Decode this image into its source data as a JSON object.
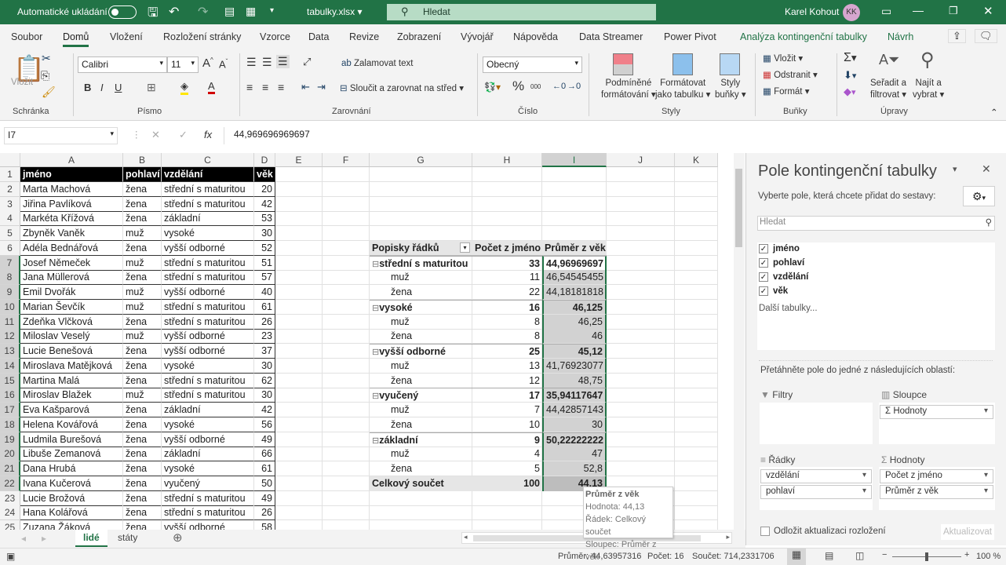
{
  "titlebar": {
    "autosave_label": "Automatické ukládání",
    "filename": "tabulky.xlsx",
    "search_placeholder": "Hledat",
    "user": "Karel Kohout",
    "initials": "KK"
  },
  "tabs": [
    "Soubor",
    "Domů",
    "Vložení",
    "Rozložení stránky",
    "Vzorce",
    "Data",
    "Revize",
    "Zobrazení",
    "Vývojář",
    "Nápověda",
    "Data Streamer",
    "Power Pivot",
    "Analýza kontingenční tabulky",
    "Návrh"
  ],
  "ribbon": {
    "paste": "Vložit",
    "clipboard": "Schránka",
    "font_name": "Calibri",
    "font_size": "11",
    "bold": "B",
    "italic": "I",
    "underline": "U",
    "font": "Písmo",
    "wrap": "Zalamovat text",
    "merge": "Sloučit a zarovnat na střed",
    "alignment": "Zarovnání",
    "number_format": "Obecný",
    "percent": "%",
    "thousands": "000",
    "number": "Číslo",
    "cond_format": [
      "Podmíněné",
      "formátování"
    ],
    "format_table": [
      "Formátovat",
      "jako tabulku"
    ],
    "cell_styles": [
      "Styly",
      "buňky"
    ],
    "styles": "Styly",
    "insert": "Vložit",
    "delete": "Odstranit",
    "format": "Formát",
    "cells": "Buňky",
    "sort": [
      "Seřadit a",
      "filtrovat"
    ],
    "find": [
      "Najít a",
      "vybrat"
    ],
    "editing": "Úpravy"
  },
  "formula": {
    "namebox": "I7",
    "value": "44,969696969697"
  },
  "columns": [
    "A",
    "B",
    "C",
    "D",
    "E",
    "F",
    "G",
    "H",
    "I",
    "J",
    "K"
  ],
  "rows": [
    [
      "jméno",
      "pohlaví",
      "vzdělání",
      "věk"
    ],
    [
      "Marta Machová",
      "žena",
      "střední s maturitou",
      "20"
    ],
    [
      "Jiřina Pavlíková",
      "žena",
      "střední s maturitou",
      "42"
    ],
    [
      "Markéta Křížová",
      "žena",
      "základní",
      "53"
    ],
    [
      "Zbyněk Vaněk",
      "muž",
      "vysoké",
      "30"
    ],
    [
      "Adéla Bednářová",
      "žena",
      "vyšší odborné",
      "52"
    ],
    [
      "Josef Němeček",
      "muž",
      "střední s maturitou",
      "51"
    ],
    [
      "Jana Müllerová",
      "žena",
      "střední s maturitou",
      "57"
    ],
    [
      "Emil Dvořák",
      "muž",
      "vyšší odborné",
      "40"
    ],
    [
      "Marian Ševčík",
      "muž",
      "střední s maturitou",
      "61"
    ],
    [
      "Zdeňka Vlčková",
      "žena",
      "střední s maturitou",
      "26"
    ],
    [
      "Miloslav Veselý",
      "muž",
      "vyšší odborné",
      "23"
    ],
    [
      "Lucie Benešová",
      "žena",
      "vyšší odborné",
      "37"
    ],
    [
      "Miroslava Matějková",
      "žena",
      "vysoké",
      "30"
    ],
    [
      "Martina Malá",
      "žena",
      "střední s maturitou",
      "62"
    ],
    [
      "Miroslav Blažek",
      "muž",
      "střední s maturitou",
      "30"
    ],
    [
      "Eva Kašparová",
      "žena",
      "základní",
      "42"
    ],
    [
      "Helena Kovářová",
      "žena",
      "vysoké",
      "56"
    ],
    [
      "Ludmila Burešová",
      "žena",
      "vyšší odborné",
      "49"
    ],
    [
      "Libuše Zemanová",
      "žena",
      "základní",
      "66"
    ],
    [
      "Dana Hrubá",
      "žena",
      "vysoké",
      "61"
    ],
    [
      "Ivana Kučerová",
      "žena",
      "vyučený",
      "50"
    ],
    [
      "Lucie Brožová",
      "žena",
      "střední s maturitou",
      "49"
    ],
    [
      "Hana Kolářová",
      "žena",
      "střední s maturitou",
      "26"
    ],
    [
      "Zuzana Žáková",
      "žena",
      "vyšší odborné",
      "58"
    ]
  ],
  "pivot": {
    "headers": [
      "Popisky řádků",
      "Počet z jméno",
      "Průměr z věk"
    ],
    "rows": [
      {
        "label": "střední s maturitou",
        "count": "33",
        "avg": "44,96969697",
        "group": true
      },
      {
        "label": "muž",
        "count": "11",
        "avg": "46,54545455",
        "group": false
      },
      {
        "label": "žena",
        "count": "22",
        "avg": "44,18181818",
        "group": false
      },
      {
        "label": "vysoké",
        "count": "16",
        "avg": "46,125",
        "group": true
      },
      {
        "label": "muž",
        "count": "8",
        "avg": "46,25",
        "group": false
      },
      {
        "label": "žena",
        "count": "8",
        "avg": "46",
        "group": false
      },
      {
        "label": "vyšší odborné",
        "count": "25",
        "avg": "45,12",
        "group": true
      },
      {
        "label": "muž",
        "count": "13",
        "avg": "41,76923077",
        "group": false
      },
      {
        "label": "žena",
        "count": "12",
        "avg": "48,75",
        "group": false
      },
      {
        "label": "vyučený",
        "count": "17",
        "avg": "35,94117647",
        "group": true
      },
      {
        "label": "muž",
        "count": "7",
        "avg": "44,42857143",
        "group": false
      },
      {
        "label": "žena",
        "count": "10",
        "avg": "30",
        "group": false
      },
      {
        "label": "základní",
        "count": "9",
        "avg": "50,22222222",
        "group": true
      },
      {
        "label": "muž",
        "count": "4",
        "avg": "47",
        "group": false
      },
      {
        "label": "žena",
        "count": "5",
        "avg": "52,8",
        "group": false
      }
    ],
    "total": {
      "label": "Celkový součet",
      "count": "100",
      "avg": "44,13"
    }
  },
  "tooltip": {
    "title": "Průměr z věk",
    "value": "Hodnota: 44,13",
    "row": "Řádek: Celkový součet",
    "column": "Sloupec: Průměr z věk"
  },
  "pane": {
    "title": "Pole kontingenční tabulky",
    "subtitle": "Vyberte pole, která chcete přidat do sestavy:",
    "search_placeholder": "Hledat",
    "fields": [
      {
        "name": "jméno",
        "checked": true
      },
      {
        "name": "pohlaví",
        "checked": true
      },
      {
        "name": "vzdělání",
        "checked": true
      },
      {
        "name": "věk",
        "checked": true
      }
    ],
    "more_tables": "Další tabulky...",
    "drag_hint": "Přetáhněte pole do jedné z následujících oblastí:",
    "filters": "Filtry",
    "columns": "Sloupce",
    "columns_items": [
      "Hodnoty"
    ],
    "rows": "Řádky",
    "rows_items": [
      "vzdělání",
      "pohlaví"
    ],
    "values": "Hodnoty",
    "values_items": [
      "Počet z jméno",
      "Průměr z věk"
    ],
    "defer": "Odložit aktualizaci rozložení",
    "update": "Aktualizovat"
  },
  "sheets": [
    {
      "name": "lidé",
      "active": true
    },
    {
      "name": "státy",
      "active": false
    }
  ],
  "status": {
    "average": "Průměr: 44,63957316",
    "count": "Počet: 16",
    "sum": "Součet: 714,2331706",
    "zoom": "100 %",
    "zoom_percent": 100
  },
  "colors": {
    "accent": "#217346",
    "header_black": "#000000",
    "selection": "#d2d2d2"
  }
}
